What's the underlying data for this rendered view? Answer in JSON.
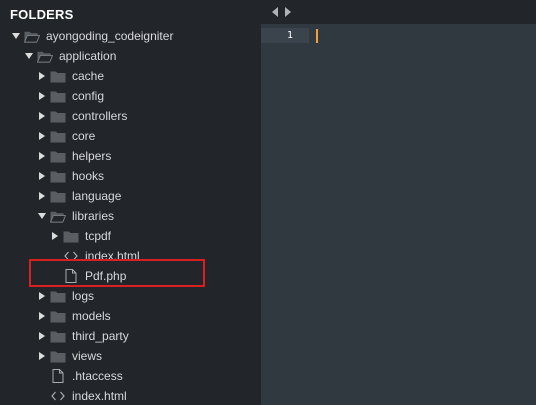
{
  "sidebar": {
    "header": "FOLDERS",
    "items": [
      {
        "label": "ayongoding_codeigniter",
        "kind": "folder",
        "state": "open",
        "depth": 0
      },
      {
        "label": "application",
        "kind": "folder",
        "state": "open",
        "depth": 1
      },
      {
        "label": "cache",
        "kind": "folder",
        "state": "closed",
        "depth": 2
      },
      {
        "label": "config",
        "kind": "folder",
        "state": "closed",
        "depth": 2
      },
      {
        "label": "controllers",
        "kind": "folder",
        "state": "closed",
        "depth": 2
      },
      {
        "label": "core",
        "kind": "folder",
        "state": "closed",
        "depth": 2
      },
      {
        "label": "helpers",
        "kind": "folder",
        "state": "closed",
        "depth": 2
      },
      {
        "label": "hooks",
        "kind": "folder",
        "state": "closed",
        "depth": 2
      },
      {
        "label": "language",
        "kind": "folder",
        "state": "closed",
        "depth": 2
      },
      {
        "label": "libraries",
        "kind": "folder",
        "state": "open",
        "depth": 2
      },
      {
        "label": "tcpdf",
        "kind": "folder",
        "state": "closed",
        "depth": 3
      },
      {
        "label": "index.html",
        "kind": "code",
        "state": "none",
        "depth": 3
      },
      {
        "label": "Pdf.php",
        "kind": "file",
        "state": "none",
        "depth": 3,
        "highlighted": true
      },
      {
        "label": "logs",
        "kind": "folder",
        "state": "closed",
        "depth": 2
      },
      {
        "label": "models",
        "kind": "folder",
        "state": "closed",
        "depth": 2
      },
      {
        "label": "third_party",
        "kind": "folder",
        "state": "closed",
        "depth": 2
      },
      {
        "label": "views",
        "kind": "folder",
        "state": "closed",
        "depth": 2
      },
      {
        "label": ".htaccess",
        "kind": "file",
        "state": "none",
        "depth": 2
      },
      {
        "label": "index.html",
        "kind": "code",
        "state": "none",
        "depth": 2
      }
    ]
  },
  "editor": {
    "line_number": "1",
    "nav_back_icon": "triangle-left-icon",
    "nav_forward_icon": "triangle-right-icon"
  },
  "colors": {
    "sidebar_bg": "#222529",
    "editor_bg": "#303840",
    "caret": "#f0a33a",
    "highlight_border": "#d91f1f",
    "folder_icon": "#5a5e63"
  }
}
